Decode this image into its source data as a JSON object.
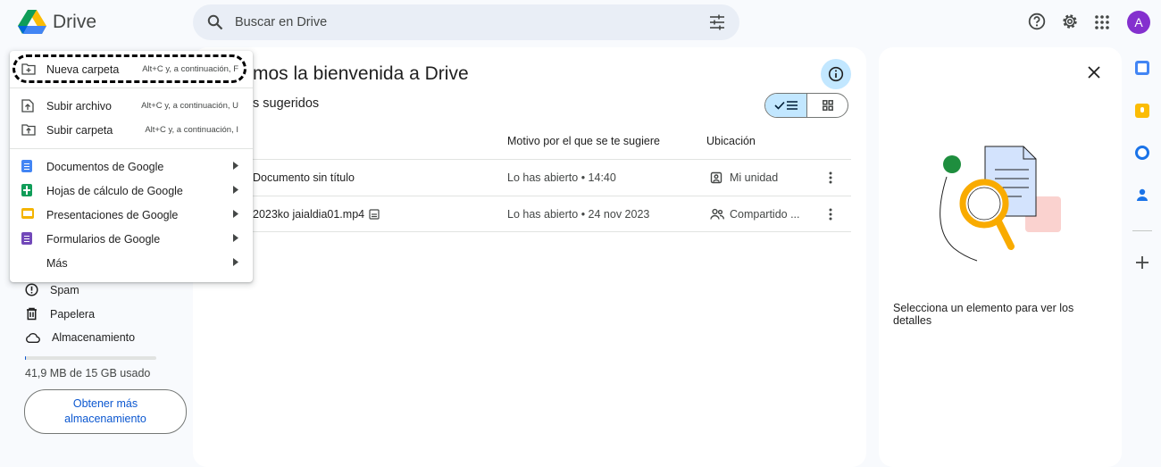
{
  "app": {
    "name": "Drive"
  },
  "search": {
    "placeholder": "Buscar en Drive"
  },
  "account": {
    "initial": "A",
    "color": "#8430ce"
  },
  "main": {
    "welcome_title": "mos la bienvenida a Drive",
    "suggested_label": "s sugeridos",
    "columns": {
      "reason": "Motivo por el que se te sugiere",
      "location": "Ubicación"
    },
    "files": [
      {
        "name": "Documento sin título",
        "reason": "Lo has abierto • 14:40",
        "location": "Mi unidad"
      },
      {
        "name": "2023ko jaialdia01.mp4",
        "reason": "Lo has abierto • 24 nov 2023",
        "location": "Compartido ..."
      }
    ]
  },
  "details": {
    "empty_text": "Selecciona un elemento para ver los detalles"
  },
  "sidebar": {
    "items": [
      {
        "label": "Spam",
        "icon": "spam-icon"
      },
      {
        "label": "Papelera",
        "icon": "trash-icon"
      },
      {
        "label": "Almacenamiento",
        "icon": "cloud-icon"
      }
    ],
    "storage_used": "41,9 MB de 15 GB usado",
    "storage_fraction": 0.003,
    "more_storage_line1": "Obtener más",
    "more_storage_line2": "almacenamiento"
  },
  "menu": {
    "new_folder": {
      "label": "Nueva carpeta",
      "shortcut": "Alt+C y, a continuación, F"
    },
    "upload_file": {
      "label": "Subir archivo",
      "shortcut": "Alt+C y, a continuación, U"
    },
    "upload_folder": {
      "label": "Subir carpeta",
      "shortcut": "Alt+C y, a continuación, I"
    },
    "docs": {
      "label": "Documentos de Google",
      "color": "#4285f4"
    },
    "sheets": {
      "label": "Hojas de cálculo de Google",
      "color": "#0f9d58"
    },
    "slides": {
      "label": "Presentaciones de Google",
      "color": "#f4b400"
    },
    "forms": {
      "label": "Formularios de Google",
      "color": "#7248b9"
    },
    "more": {
      "label": "Más"
    }
  },
  "colors": {
    "accent": "#0b57d0",
    "selected": "#c2e7ff",
    "background": "#f8fafd"
  }
}
